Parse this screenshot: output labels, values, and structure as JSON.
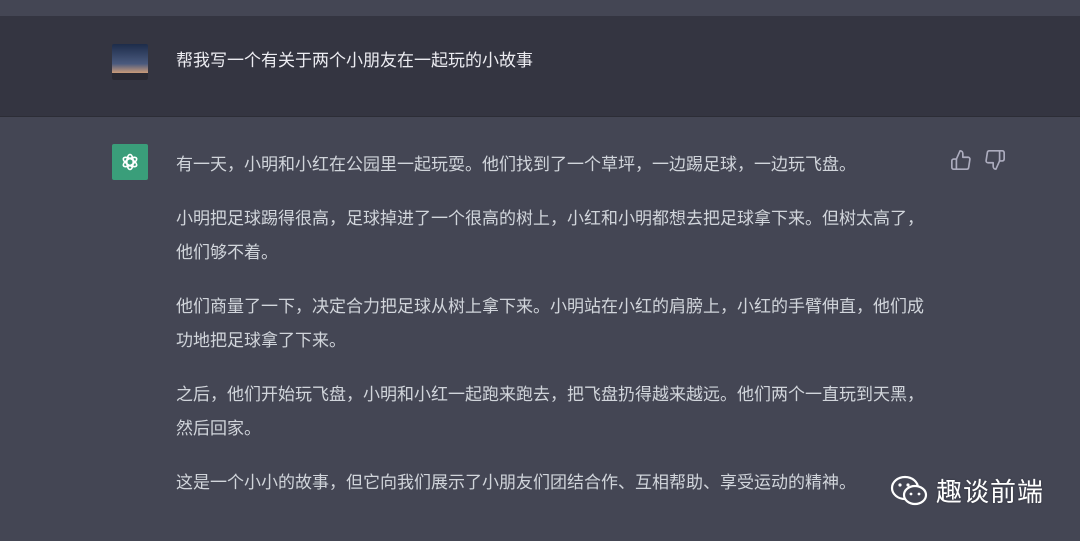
{
  "user_message": {
    "text": "帮我写一个有关于两个小朋友在一起玩的小故事"
  },
  "assistant_message": {
    "paragraphs": [
      "有一天，小明和小红在公园里一起玩耍。他们找到了一个草坪，一边踢足球，一边玩飞盘。",
      "小明把足球踢得很高，足球掉进了一个很高的树上，小红和小明都想去把足球拿下来。但树太高了，他们够不着。",
      "他们商量了一下，决定合力把足球从树上拿下来。小明站在小红的肩膀上，小红的手臂伸直，他们成功地把足球拿了下来。",
      "之后，他们开始玩飞盘，小明和小红一起跑来跑去，把飞盘扔得越来越远。他们两个一直玩到天黑，然后回家。",
      "这是一个小小的故事，但它向我们展示了小朋友们团结合作、互相帮助、享受运动的精神。"
    ]
  },
  "icons": {
    "thumbs_up": "thumbs-up-icon",
    "thumbs_down": "thumbs-down-icon",
    "bot": "openai-logo-icon",
    "watermark": "wechat-icon"
  },
  "watermark": {
    "text": "趣谈前端"
  },
  "colors": {
    "user_bg": "#343541",
    "assistant_bg": "#444654",
    "bot_avatar": "#3a9e7a"
  }
}
